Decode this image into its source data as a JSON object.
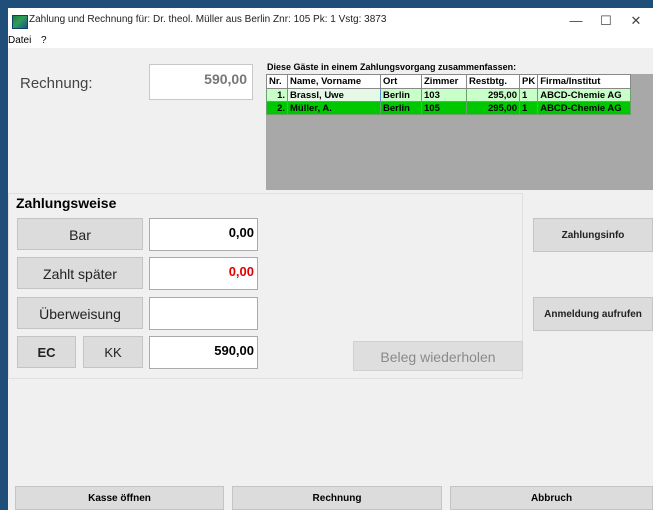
{
  "window": {
    "title": "Zahlung und Rechnung für: Dr. theol. Müller  aus Berlin  Znr: 105  Pk: 1  Vstg: 3873",
    "minimize": "—",
    "maximize": "☐",
    "close": "✕"
  },
  "menu": {
    "file": "Datei",
    "help": "?"
  },
  "rechnung": {
    "label": "Rechnung:",
    "value": "590,00"
  },
  "guests": {
    "caption": "Diese Gäste in einem Zahlungsvorgang zusammenfassen:",
    "columns": [
      "Nr.",
      "Name, Vorname",
      "Ort",
      "Zimmer",
      "Restbtg.",
      "PK",
      "Firma/Institut"
    ],
    "rows": [
      {
        "nr": "1.",
        "name": "Brassl, Uwe",
        "ort": "Berlin",
        "zimmer": "103",
        "rest": "295,00",
        "pk": "1",
        "firma": "ABCD-Chemie AG"
      },
      {
        "nr": "2.",
        "name": "Müller, A.",
        "ort": "Berlin",
        "zimmer": "105",
        "rest": "295,00",
        "pk": "1",
        "firma": "ABCD-Chemie AG"
      }
    ]
  },
  "zahlungsweise": {
    "title": "Zahlungsweise",
    "bar_label": "Bar",
    "bar_value": "0,00",
    "spaeter_label": "Zahlt später",
    "spaeter_value": "0,00",
    "ueberweisung_label": "Überweisung",
    "ueberweisung_value": "",
    "ec_label": "EC",
    "kk_label": "KK",
    "ec_value": "590,00",
    "beleg_label": "Beleg wiederholen"
  },
  "side": {
    "zahlungsinfo": "Zahlungsinfo",
    "anmeldung": "Anmeldung aufrufen"
  },
  "bottom": {
    "kasse": "Kasse öffnen",
    "rechnung": "Rechnung",
    "abbruch": "Abbruch"
  },
  "colors": {
    "window_frame": "#1f4e79",
    "row_selected_light": "#c8ffc8",
    "row_green": "#00c800",
    "negative_red": "#e00000"
  }
}
